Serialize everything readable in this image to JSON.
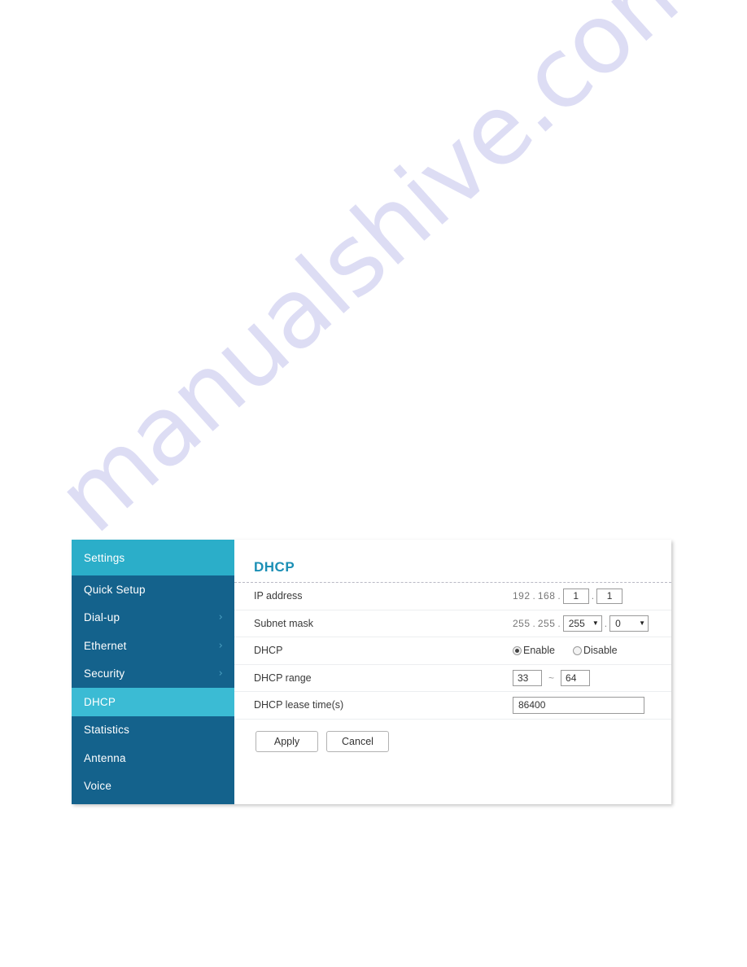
{
  "watermark": {
    "text": "manualshive.com"
  },
  "sidebar": {
    "header": "Settings",
    "items": [
      {
        "label": "Quick Setup",
        "chevron": "",
        "active": false
      },
      {
        "label": "Dial-up",
        "chevron": "›",
        "active": false
      },
      {
        "label": "Ethernet",
        "chevron": "›",
        "active": false
      },
      {
        "label": "Security",
        "chevron": "›",
        "active": false
      },
      {
        "label": "DHCP",
        "chevron": "",
        "active": true
      },
      {
        "label": "Statistics",
        "chevron": "",
        "active": false
      },
      {
        "label": "Antenna",
        "chevron": "",
        "active": false
      },
      {
        "label": "Voice",
        "chevron": "",
        "active": false
      }
    ]
  },
  "panel": {
    "title": "DHCP",
    "rows": {
      "ip_address": {
        "label": "IP address",
        "octet1": "192",
        "octet2": "168",
        "octet3": "1",
        "octet4": "1",
        "separator": "."
      },
      "subnet_mask": {
        "label": "Subnet mask",
        "octet1": "255",
        "octet2": "255",
        "octet3": "255",
        "octet4": "0",
        "separator": ".",
        "caret": "▼"
      },
      "dhcp": {
        "label": "DHCP",
        "enable_label": "Enable",
        "disable_label": "Disable",
        "selected": "Enable"
      },
      "dhcp_range": {
        "label": "DHCP range",
        "start": "33",
        "end": "64",
        "dash": "~"
      },
      "lease_time": {
        "label": "DHCP lease time(s)",
        "value": "86400"
      }
    },
    "buttons": {
      "apply": "Apply",
      "cancel": "Cancel"
    }
  },
  "colors": {
    "sidebar_bg": "#14628C",
    "sidebar_header_bg": "#2BAEC9",
    "sidebar_active_bg": "#3BBBD4",
    "title_accent": "#1B8FB5",
    "watermark": "#c9c9ee"
  }
}
